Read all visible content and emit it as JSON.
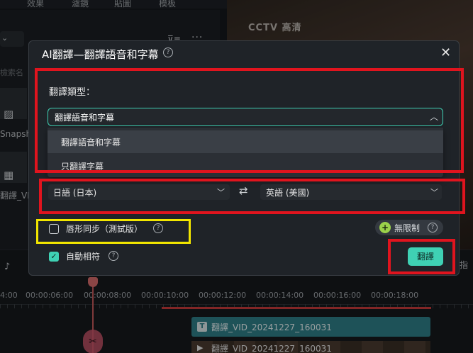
{
  "background": {
    "tabs": [
      "效果",
      "濾鏡",
      "貼圖",
      "模板"
    ],
    "left_dropdown": "\u0002\u0002\u0002",
    "search_placeholder": "檢索名",
    "media_items": [
      {
        "label": "Snapsh",
        "icon": "image-icon"
      },
      {
        "label": "翻譯_VI",
        "icon": "film-icon"
      }
    ],
    "preview_logo": "CCTV 高清",
    "right_edge_label": "指",
    "timeline": {
      "ticks": [
        "4:00",
        "00:00:06:00",
        "00:00:08:00",
        "00:00:10:00",
        "00:00:12:00",
        "00:00:14:00",
        "00:00:16:00",
        "00:00:18:00"
      ],
      "subtitle_clip": "翻譯_VID_20241227_160031",
      "video_clip": "翻譯_VID_20241227_160031"
    }
  },
  "dialog": {
    "title": "AI翻譯—翻譯語音和字幕",
    "close": "✕",
    "type_label": "翻譯類型：",
    "type_selected": "翻譯語音和字幕",
    "type_options": [
      "翻譯語音和字幕",
      "只翻譯字幕"
    ],
    "source_language": "日語 (日本)",
    "target_language": "英語 (美國)",
    "lipsync_label": "唇形同步（測試版）",
    "lipsync_checked": false,
    "auto_match_label": "自動相符",
    "auto_match_checked": true,
    "unlimited_label": "無限制",
    "translate_button": "翻譯"
  },
  "colors": {
    "accent": "#3fd1b4",
    "annotation_red": "#e0141e",
    "annotation_yellow": "#f2e600"
  }
}
